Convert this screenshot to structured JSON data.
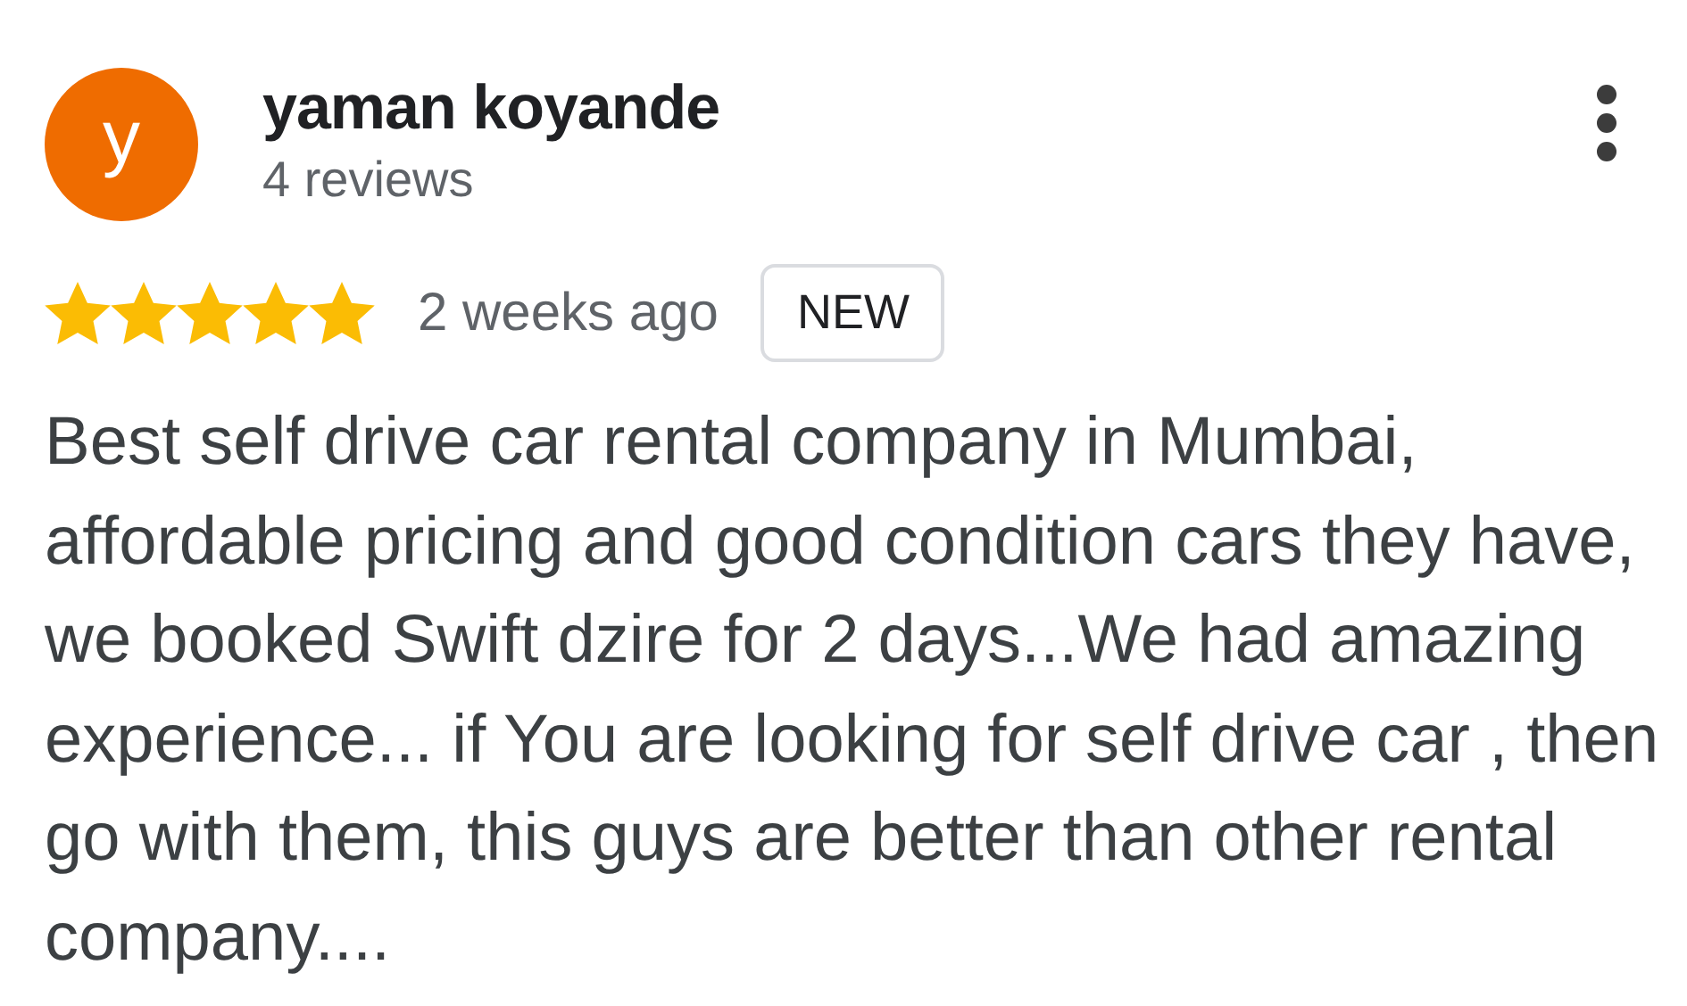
{
  "review": {
    "avatar_letter": "y",
    "author": "yaman koyande",
    "author_meta": "4 reviews",
    "stars": 5,
    "time": "2 weeks ago",
    "badge": "NEW",
    "text": "Best self drive car rental company in Mumbai, affordable pricing and good condition cars they have, we booked Swift dzire for 2 days...We had amazing experience... if You are looking for self drive car , then go with them, this guys are better than other rental company...."
  }
}
